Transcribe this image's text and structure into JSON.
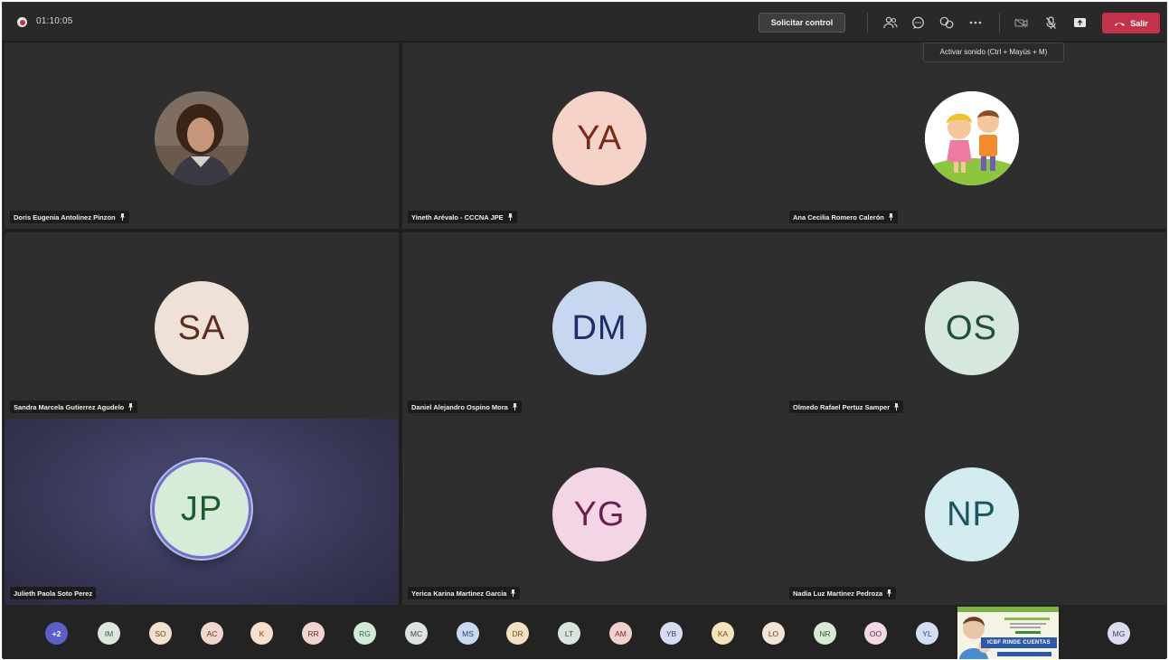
{
  "topbar": {
    "timer": "01:10:05",
    "request_control_label": "Solicitar control",
    "leave_label": "Salir",
    "tooltip": "Activar sonido (Ctrl + Mayús + M)"
  },
  "tiles": [
    {
      "name": "Doris Eugenia Antolinez Pinzon",
      "initials": "",
      "bg": "",
      "fg": "",
      "photo": "woman-photo"
    },
    {
      "name": "Yineth Arévalo - CCCNA JPE",
      "initials": "YA",
      "bg": "#f6d3c8",
      "fg": "#7a2a18"
    },
    {
      "name": "Ana Cecilia Romero Calerón",
      "initials": "",
      "bg": "",
      "fg": "",
      "photo": "cartoon-kids-photo"
    },
    {
      "name": "Sandra Marcela Gutierrez Agudelo",
      "initials": "SA",
      "bg": "#efe0d8",
      "fg": "#5a2e1c"
    },
    {
      "name": "Daniel Alejandro Ospino Mora",
      "initials": "DM",
      "bg": "#c7d7ef",
      "fg": "#1d2f66"
    },
    {
      "name": "Olmedo Rafael Pertuz Samper",
      "initials": "OS",
      "bg": "#d6e8de",
      "fg": "#1f4f36"
    },
    {
      "name": "Julieth Paola Soto Perez",
      "initials": "JP",
      "bg": "#d6ecd8",
      "fg": "#1e5a2c",
      "active": true
    },
    {
      "name": "Yerica Karina Martinez Garcia",
      "initials": "YG",
      "bg": "#f3d5e6",
      "fg": "#6a1f4c"
    },
    {
      "name": "Nadia Luz Martinez Pedroza",
      "initials": "NP",
      "bg": "#d2ecef",
      "fg": "#1a5560"
    }
  ],
  "overflow": {
    "more_label": "+2",
    "chips": [
      {
        "initials": "IM",
        "bg": "#dce6dd",
        "fg": "#3f5f47"
      },
      {
        "initials": "SO",
        "bg": "#f2e1cf",
        "fg": "#6a4420"
      },
      {
        "initials": "AC",
        "bg": "#f0d6cd",
        "fg": "#7a2f20"
      },
      {
        "initials": "K",
        "bg": "#f7dfcc",
        "fg": "#7a4418"
      },
      {
        "initials": "RR",
        "bg": "#efd5cd",
        "fg": "#6e3024"
      },
      {
        "initials": "RG",
        "bg": "#d3ead8",
        "fg": "#2f6b41"
      },
      {
        "initials": "MC",
        "bg": "#dde3de",
        "fg": "#3b4a40"
      },
      {
        "initials": "MS",
        "bg": "#c9d9f0",
        "fg": "#22427a"
      },
      {
        "initials": "DR",
        "bg": "#f2e2c2",
        "fg": "#6c5118"
      },
      {
        "initials": "LT",
        "bg": "#d8e4dc",
        "fg": "#355443"
      },
      {
        "initials": "AM",
        "bg": "#f1d0d0",
        "fg": "#7a2a2a"
      },
      {
        "initials": "YB",
        "bg": "#d8dcf2",
        "fg": "#323c7a"
      },
      {
        "initials": "KA",
        "bg": "#f4e3bd",
        "fg": "#6f5315"
      },
      {
        "initials": "LO",
        "bg": "#f2e4d6",
        "fg": "#6a4a2c"
      },
      {
        "initials": "NR",
        "bg": "#d8ead6",
        "fg": "#33602f"
      },
      {
        "initials": "OO",
        "bg": "#f3d8e6",
        "fg": "#6c2a50"
      },
      {
        "initials": "YL",
        "bg": "#d3def2",
        "fg": "#29467c"
      }
    ],
    "content_thumb_text": "ICBF RINDE CUENTAS",
    "last_chip": {
      "initials": "MG",
      "bg": "#dcdcf0",
      "fg": "#3c3c6e"
    }
  },
  "colors": {
    "more_chip_bg": "#5b5fc7",
    "leave_red": "#c4314b",
    "tile_bg": "#2e2e2e",
    "active_ring": "#6f72c4"
  },
  "icons": [
    "record-icon",
    "participants-icon",
    "chat-icon",
    "reactions-icon",
    "more-options-icon",
    "camera-icon",
    "mic-muted-icon",
    "share-icon",
    "phone-hangup-icon",
    "pin-icon"
  ]
}
